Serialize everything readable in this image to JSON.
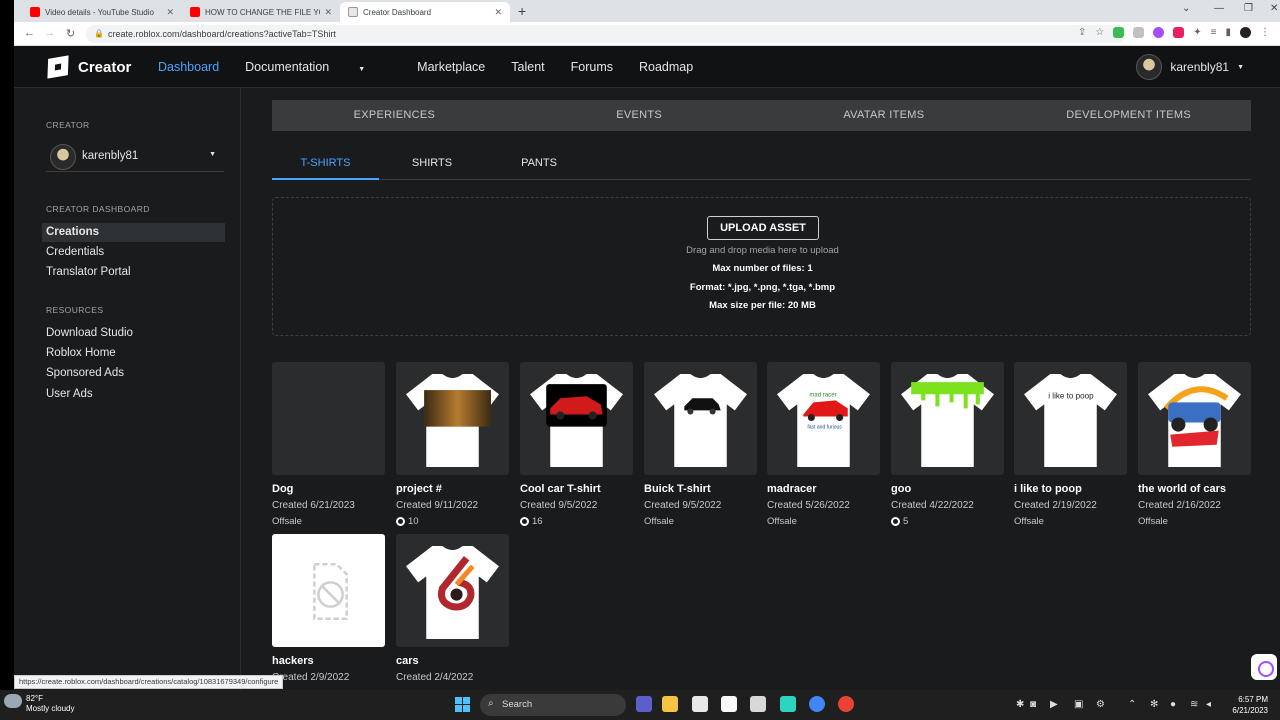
{
  "browser": {
    "tabs": [
      {
        "title": "Video details - YouTube Studio",
        "favicon_color": "#ff0000"
      },
      {
        "title": "HOW TO CHANGE THE FILE YOU...",
        "favicon_color": "#ff0000"
      },
      {
        "title": "Creator Dashboard",
        "favicon_color": "#ffffff"
      }
    ],
    "url": "create.roblox.com/dashboard/creations?activeTab=TShirt",
    "status_url": "https://create.roblox.com/dashboard/creations/catalog/10831679349/configure"
  },
  "header": {
    "brand": "Creator",
    "nav": [
      {
        "label": "Dashboard",
        "active": true
      },
      {
        "label": "Documentation",
        "dropdown": true
      },
      {
        "label": "Marketplace"
      },
      {
        "label": "Talent"
      },
      {
        "label": "Forums"
      },
      {
        "label": "Roadmap"
      }
    ],
    "username": "karenbly81"
  },
  "sidebar": {
    "creator_heading": "CREATOR",
    "creator_name": "karenbly81",
    "dashboard_heading": "CREATOR DASHBOARD",
    "dashboard_items": [
      "Creations",
      "Credentials",
      "Translator Portal"
    ],
    "resources_heading": "RESOURCES",
    "resource_items": [
      "Download Studio",
      "Roblox Home",
      "Sponsored Ads",
      "User Ads"
    ]
  },
  "main": {
    "category_tabs": [
      "EXPERIENCES",
      "EVENTS",
      "AVATAR ITEMS",
      "DEVELOPMENT ITEMS"
    ],
    "sub_tabs": [
      "T-SHIRTS",
      "SHIRTS",
      "PANTS"
    ],
    "upload": {
      "button": "UPLOAD ASSET",
      "hint": "Drag and drop media here to upload",
      "max_files": "Max number of files: 1",
      "formats": "Format: *.jpg, *.png, *.tga, *.bmp",
      "max_size": "Max size per file: 20 MB"
    },
    "items": [
      {
        "name": "Dog",
        "date": "Created 6/21/2023",
        "status": "Offsale",
        "robux": false
      },
      {
        "name": "project #",
        "date": "Created 9/11/2022",
        "status": "10",
        "robux": true
      },
      {
        "name": "Cool car T-shirt",
        "date": "Created 9/5/2022",
        "status": "16",
        "robux": true
      },
      {
        "name": "Buick T-shirt",
        "date": "Created 9/5/2022",
        "status": "Offsale",
        "robux": false
      },
      {
        "name": "madracer",
        "date": "Created 5/26/2022",
        "status": "Offsale",
        "robux": false
      },
      {
        "name": "goo",
        "date": "Created 4/22/2022",
        "status": "5",
        "robux": true
      },
      {
        "name": "i like to poop",
        "date": "Created 2/19/2022",
        "status": "Offsale",
        "robux": false
      },
      {
        "name": "the world of cars",
        "date": "Created 2/16/2022",
        "status": "Offsale",
        "robux": false
      },
      {
        "name": "hackers",
        "date": "Created 2/9/2022",
        "status": "",
        "robux": false
      },
      {
        "name": "cars",
        "date": "Created 2/4/2022",
        "status": "Offsale",
        "robux": false
      }
    ],
    "shirt_text": {
      "poop": "i like to poop",
      "madracer": "mad racer",
      "madracer_sub": "fast and furious"
    }
  },
  "taskbar": {
    "temperature": "82°F",
    "weather": "Mostly cloudy",
    "search": "Search",
    "time": "6:57 PM",
    "date": "6/21/2023"
  }
}
